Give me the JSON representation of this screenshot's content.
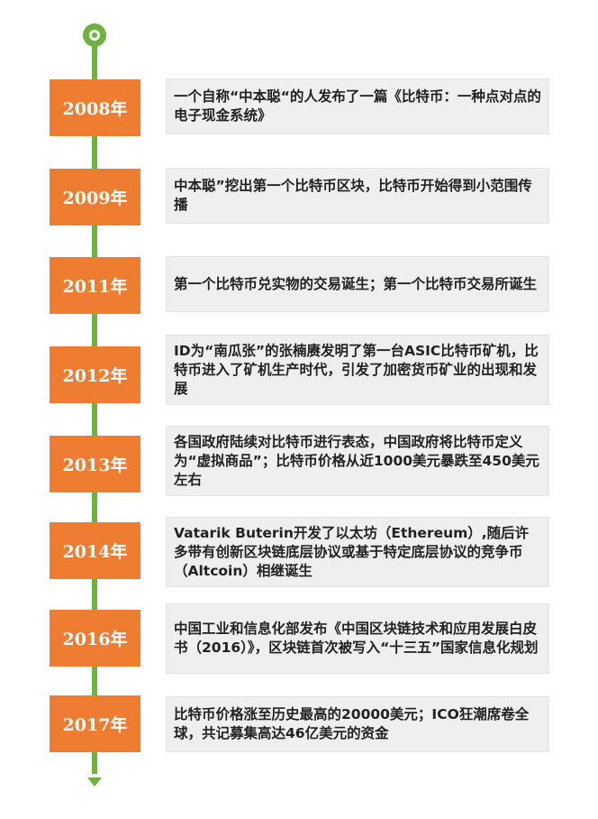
{
  "timeline": {
    "events": [
      {
        "year": "2008年",
        "text": "一个自称“中本聪“的人发布了一篇《比特币：一种点对点的电子现金系统》"
      },
      {
        "year": "2009年",
        "text": "中本聪”挖出第一个比特币区块，比特币开始得到小范围传播"
      },
      {
        "year": "2011年",
        "text": "第一个比特币兑实物的交易诞生；第一个比特币交易所诞生"
      },
      {
        "year": "2012年",
        "text": "ID为“南瓜张”的张楠赓发明了第一台ASIC比特币矿机，比特币进入了矿机生产时代，引发了加密货币矿业的出现和发展"
      },
      {
        "year": "2013年",
        "text": "各国政府陆续对比特币进行表态，中国政府将比特币定义为“虚拟商品”；比特币价格从近1000美元暴跌至450美元左右"
      },
      {
        "year": "2014年",
        "text": "Vatarik Buterin开发了以太坊（Ethereum）,随后许多带有创新区块链底层协议或基于特定底层协议的竞争币（Altcoin）相继诞生"
      },
      {
        "year": "2016年",
        "text": "中国工业和信息化部发布《中国区块链技术和应用发展白皮书（2016）》，区块链首次被写入“十三五”国家信息化规划"
      },
      {
        "year": "2017年",
        "text": "比特币价格涨至历史最高的20000美元；ICO狂潮席卷全球，共记募集高达46亿美元的资金"
      }
    ]
  }
}
